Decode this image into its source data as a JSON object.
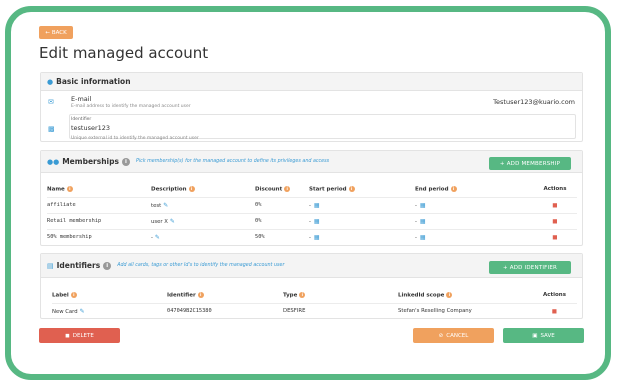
{
  "header": {
    "back_label": "BACK",
    "title": "Edit managed account"
  },
  "basic_info": {
    "title": "Basic information",
    "email": {
      "label": "E-mail",
      "help": "E-mail address to identify the managed account user",
      "value": "Testuser123@kuario.com"
    },
    "identifier": {
      "label": "Identifier",
      "value": "testuser123",
      "help": "Unique external id to identify the managed account user"
    }
  },
  "memberships": {
    "title": "Memberships",
    "hint": "Pick membership(s) for the managed account to define its privileges and access",
    "add_label": "ADD MEMBERSHIP",
    "columns": [
      "Name",
      "Description",
      "Discount",
      "Start period",
      "End period",
      "Actions"
    ],
    "rows": [
      {
        "name": "affiliate",
        "description": "test",
        "discount": "0%",
        "start": "-",
        "end": "-"
      },
      {
        "name": "Retail membership",
        "description": "user X",
        "discount": "0%",
        "start": "-",
        "end": "-"
      },
      {
        "name": "50% membership",
        "description": "-",
        "discount": "50%",
        "start": "-",
        "end": "-"
      }
    ]
  },
  "identifiers": {
    "title": "Identifiers",
    "hint": "Add all cards, tags or other Id's to identify the managed account user",
    "add_label": "ADD IDENTIFIER",
    "columns": [
      "Label",
      "Identifier",
      "Type",
      "LinkedId scope",
      "Actions"
    ],
    "rows": [
      {
        "label": "New Card",
        "identifier": "047049B2C15380",
        "type": "DESFIRE",
        "scope": "Stefan's Reselling Company"
      }
    ]
  },
  "footer": {
    "delete_label": "DELETE",
    "cancel_label": "CANCEL",
    "save_label": "SAVE"
  },
  "colors": {
    "green": "#57b883",
    "orange": "#f0a15e",
    "red": "#e06050",
    "blue": "#3a9bd4"
  }
}
